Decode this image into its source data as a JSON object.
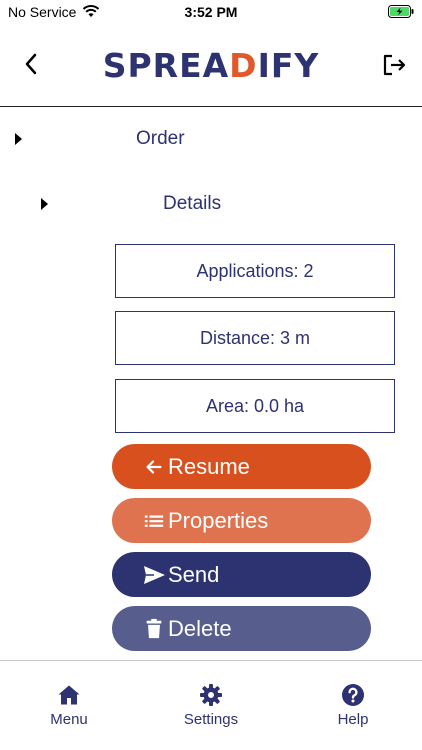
{
  "status_bar": {
    "carrier": "No Service",
    "time": "3:52 PM"
  },
  "header": {
    "logo_prefix": "SPREA",
    "logo_accent": "D",
    "logo_suffix": "IFY"
  },
  "tree": {
    "order_label": "Order",
    "details_label": "Details"
  },
  "details": {
    "applications": "Applications: 2",
    "distance": "Distance: 3 m",
    "area": "Area: 0.0 ha"
  },
  "actions": {
    "resume": "Resume",
    "properties": "Properties",
    "send": "Send",
    "delete": "Delete"
  },
  "tab_bar": {
    "menu": "Menu",
    "settings": "Settings",
    "help": "Help"
  },
  "colors": {
    "brand_navy": "#2d3270",
    "brand_orange": "#e1592b",
    "resume_bg": "#d9501f",
    "properties_bg": "#e0734f",
    "send_bg": "#2d3270",
    "delete_bg": "#575e8e"
  },
  "icons": {
    "status": [
      "wifi-icon",
      "battery-charging-icon"
    ],
    "header": [
      "back-icon",
      "logout-icon"
    ],
    "actions": [
      "arrow-left-icon",
      "list-icon",
      "send-icon",
      "trash-icon"
    ],
    "tabs": [
      "home-icon",
      "gear-icon",
      "help-icon"
    ]
  }
}
